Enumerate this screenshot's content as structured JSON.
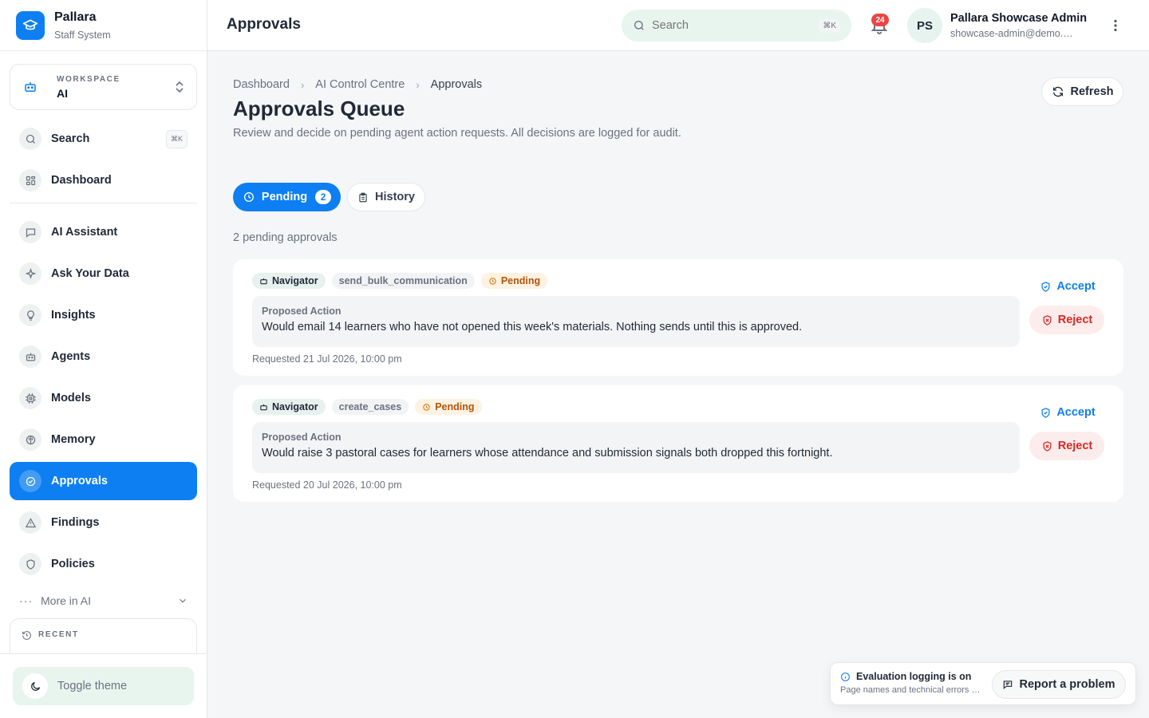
{
  "brand": {
    "name": "Pallara",
    "subtitle": "Staff System"
  },
  "workspace": {
    "label": "WORKSPACE",
    "value": "AI"
  },
  "sidebar": {
    "search": {
      "label": "Search",
      "shortcut": "⌘K"
    },
    "items": [
      {
        "label": "Dashboard",
        "icon": "grid-icon"
      },
      {
        "label": "AI Assistant",
        "icon": "chat-icon"
      },
      {
        "label": "Ask Your Data",
        "icon": "sparkle-icon"
      },
      {
        "label": "Insights",
        "icon": "lightbulb-icon"
      },
      {
        "label": "Agents",
        "icon": "robot-icon"
      },
      {
        "label": "Models",
        "icon": "chip-icon"
      },
      {
        "label": "Memory",
        "icon": "brain-icon"
      },
      {
        "label": "Approvals",
        "icon": "check-circle-icon",
        "active": true
      },
      {
        "label": "Findings",
        "icon": "warning-icon"
      },
      {
        "label": "Policies",
        "icon": "shield-icon"
      }
    ],
    "more": "More in AI",
    "recent": "RECENT",
    "toggle_theme": "Toggle theme"
  },
  "header": {
    "title": "Approvals",
    "search_placeholder": "Search",
    "search_shortcut": "⌘K",
    "notifications": "24",
    "avatar_initials": "PS",
    "user_name": "Pallara Showcase Admin",
    "user_email": "showcase-admin@demo.pallara.app"
  },
  "breadcrumb": [
    "Dashboard",
    "AI Control Centre",
    "Approvals"
  ],
  "page": {
    "title": "Approvals Queue",
    "description": "Review and decide on pending agent action requests. All decisions are logged for audit.",
    "refresh": "Refresh"
  },
  "tabs": {
    "pending": "Pending",
    "pending_count": "2",
    "history": "History"
  },
  "pending_summary": "2 pending approvals",
  "approvals": [
    {
      "agent": "Navigator",
      "tool": "send_bulk_communication",
      "status": "Pending",
      "proposal_label": "Proposed Action",
      "proposal": "Would email 14 learners who have not opened this week's materials. Nothing sends until this is approved.",
      "requested": "Requested 21 Jul 2026, 10:00 pm",
      "accept": "Accept",
      "reject": "Reject"
    },
    {
      "agent": "Navigator",
      "tool": "create_cases",
      "status": "Pending",
      "proposal_label": "Proposed Action",
      "proposal": "Would raise 3 pastoral cases for learners whose attendance and submission signals both dropped this fortnight.",
      "requested": "Requested 20 Jul 2026, 10:00 pm",
      "accept": "Accept",
      "reject": "Reject"
    }
  ],
  "toast": {
    "title": "Evaluation logging is on",
    "subtitle": "Page names and technical errors are logged",
    "report": "Report a problem"
  },
  "colors": {
    "accent": "#0d7ff2",
    "mint": "#e8f5ef",
    "danger": "#dc2626",
    "warning": "#b45309"
  }
}
